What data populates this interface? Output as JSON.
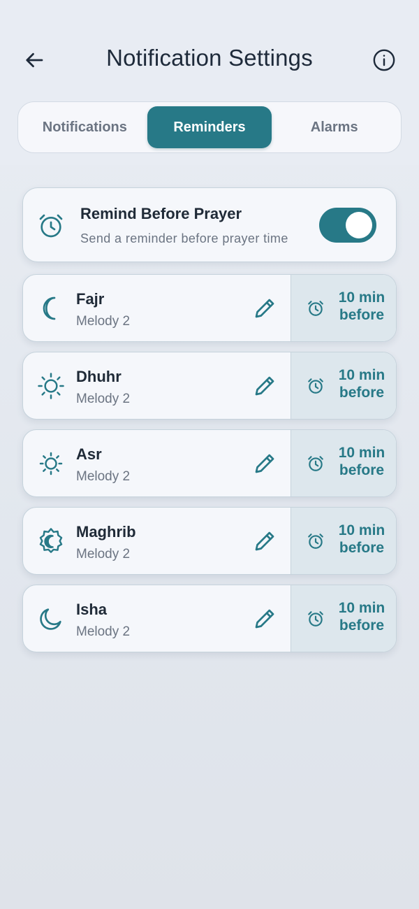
{
  "header": {
    "title": "Notification Settings",
    "back_icon": "arrow-left-icon",
    "info_icon": "info-icon"
  },
  "tabs": [
    {
      "label": "Notifications",
      "active": false
    },
    {
      "label": "Reminders",
      "active": true
    },
    {
      "label": "Alarms",
      "active": false
    }
  ],
  "remind_before": {
    "title": "Remind Before Prayer",
    "subtitle": "Send a reminder before prayer time",
    "enabled": true,
    "icon": "alarm-clock-icon"
  },
  "prayers": [
    {
      "name": "Fajr",
      "sound": "Melody 2",
      "offset_value": "10 min",
      "offset_suffix": "before",
      "icon": "crescent-moon-icon"
    },
    {
      "name": "Dhuhr",
      "sound": "Melody 2",
      "offset_value": "10 min",
      "offset_suffix": "before",
      "icon": "sun-icon"
    },
    {
      "name": "Asr",
      "sound": "Melody 2",
      "offset_value": "10 min",
      "offset_suffix": "before",
      "icon": "sun-small-icon"
    },
    {
      "name": "Maghrib",
      "sound": "Melody 2",
      "offset_value": "10 min",
      "offset_suffix": "before",
      "icon": "moon-badge-icon"
    },
    {
      "name": "Isha",
      "sound": "Melody 2",
      "offset_value": "10 min",
      "offset_suffix": "before",
      "icon": "moon-icon"
    }
  ],
  "colors": {
    "accent": "#277987",
    "card_bg": "#f5f7fb",
    "offset_bg": "#dde7ed",
    "text_primary": "#1f2a37",
    "text_secondary": "#6b7482"
  }
}
